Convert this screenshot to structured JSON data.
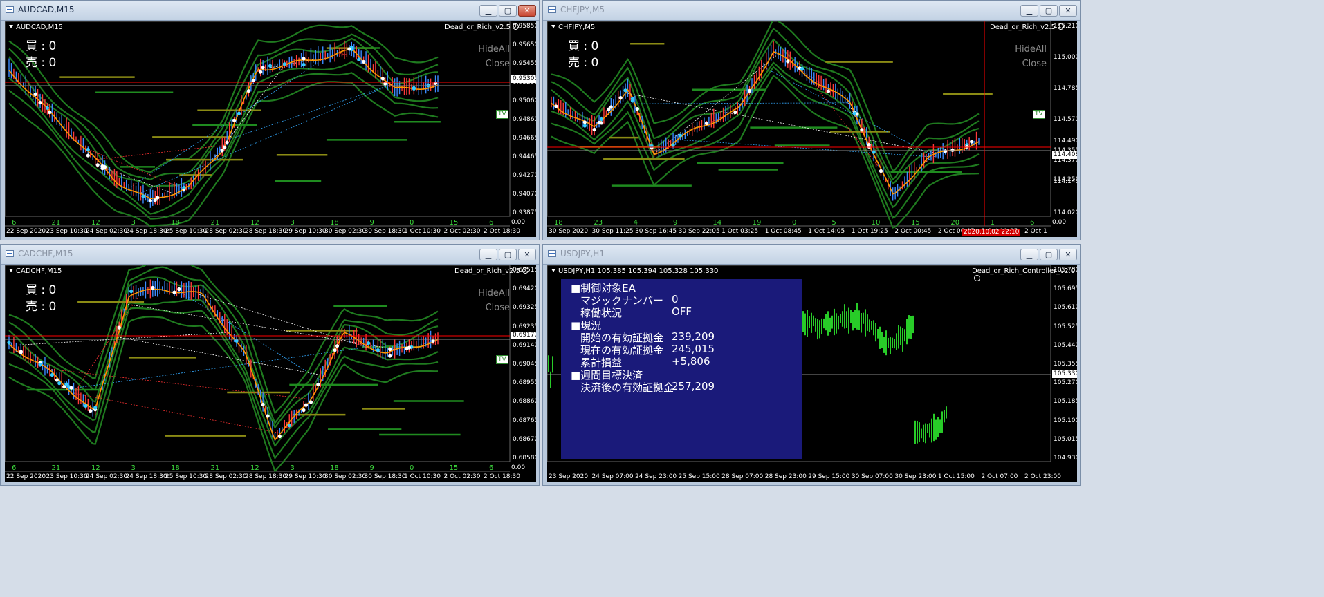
{
  "windows": {
    "audcad": {
      "title": "AUDCAD,M15",
      "symbol": "AUDCAD,M15",
      "indicator": "Dead_or_Rich_v2.5",
      "buy": "買 : 0",
      "sell": "売 : 0",
      "hideall": "HideAll",
      "close_label": "Close",
      "tv": "TV",
      "prices": [
        "0.95850",
        "0.95650",
        "0.95455",
        "0.95255",
        "0.95060",
        "0.94860",
        "0.94665",
        "0.94465",
        "0.94270",
        "0.94070",
        "0.93875"
      ],
      "price_current": "0.95305",
      "price_zero": "0.00",
      "times": [
        "22 Sep 2020",
        "23 Sep 10:30",
        "24 Sep 02:30",
        "24 Sep 18:30",
        "25 Sep 10:30",
        "28 Sep 02:30",
        "28 Sep 18:30",
        "29 Sep 10:30",
        "30 Sep 02:30",
        "30 Sep 18:30",
        "1 Oct 10:30",
        "2 Oct 02:30",
        "2 Oct 18:30"
      ],
      "tick_numbers": [
        "6",
        "21",
        "12",
        "3",
        "18",
        "21",
        "12",
        "3",
        "18",
        "9",
        "0",
        "15",
        "6"
      ]
    },
    "chfjpy": {
      "title": "CHFJPY,M5",
      "symbol": "CHFJPY,M5",
      "indicator": "Dead_or_Rich_v2.5",
      "buy": "買 : 0",
      "sell": "売 : 0",
      "hideall": "HideAll",
      "close_label": "Close",
      "tv": "TV",
      "prices": [
        "115.210",
        "115.000",
        "114.785",
        "114.570",
        "114.355",
        "114.140",
        "114.020"
      ],
      "prices_mid": [
        "114.490",
        "114.370",
        "114.250"
      ],
      "price_current": "114.408",
      "price_zero": "0.00",
      "times": [
        "30 Sep 2020",
        "30 Sep 11:25",
        "30 Sep 16:45",
        "30 Sep 22:05",
        "1 Oct 03:25",
        "1 Oct 08:45",
        "1 Oct 14:05",
        "1 Oct 19:25",
        "2 Oct 00:45",
        "2 Oct 06:05",
        "2 Oct 11:25",
        "2 Oct 1"
      ],
      "time_marker": "2020.10.02 22:10",
      "tick_numbers": [
        "18",
        "23",
        "4",
        "9",
        "14",
        "19",
        "0",
        "5",
        "10",
        "15",
        "20",
        "1",
        "6"
      ]
    },
    "cadchf": {
      "title": "CADCHF,M15",
      "symbol": "CADCHF,M15",
      "indicator": "Dead_or_Rich_v2.5",
      "buy": "買 : 0",
      "sell": "売 : 0",
      "hideall": "HideAll",
      "close_label": "Close",
      "tv": "TV",
      "prices": [
        "0.69515",
        "0.69420",
        "0.69325",
        "0.69235",
        "0.69140",
        "0.69045",
        "0.68955",
        "0.68860",
        "0.68765",
        "0.68670",
        "0.68580"
      ],
      "price_current": "0.69177",
      "price_zero": "0.00",
      "times": [
        "22 Sep 2020",
        "23 Sep 10:30",
        "24 Sep 02:30",
        "24 Sep 18:30",
        "25 Sep 10:30",
        "28 Sep 02:30",
        "28 Sep 18:30",
        "29 Sep 10:30",
        "30 Sep 02:30",
        "30 Sep 18:30",
        "1 Oct 10:30",
        "2 Oct 02:30",
        "2 Oct 18:30"
      ],
      "tick_numbers": [
        "6",
        "21",
        "12",
        "3",
        "18",
        "21",
        "12",
        "3",
        "18",
        "9",
        "0",
        "15",
        "6"
      ]
    },
    "usdjpy": {
      "title": "USDJPY,H1",
      "symbol": "USDJPY,H1  105.385 105.394 105.328 105.330",
      "indicator": "Dead_or_Rich_Controller_v2.0",
      "prices": [
        "105.780",
        "105.695",
        "105.610",
        "105.525",
        "105.440",
        "105.355",
        "105.270",
        "105.185",
        "105.100",
        "105.015",
        "104.930"
      ],
      "price_current": "105.330",
      "times": [
        "23 Sep 2020",
        "24 Sep 07:00",
        "24 Sep 23:00",
        "25 Sep 15:00",
        "28 Sep 07:00",
        "28 Sep 23:00",
        "29 Sep 15:00",
        "30 Sep 07:00",
        "30 Sep 23:00",
        "1 Oct 15:00",
        "2 Oct 07:00",
        "2 Oct 23:00"
      ],
      "panel": {
        "h1": "■制御対象EA",
        "magic_label": "マジックナンバー",
        "magic_value": "0",
        "status_label": "稼働状況",
        "status_value": "OFF",
        "h2": "■現況",
        "start_label": "開始の有効証拠金",
        "start_value": "239,209",
        "current_label": "現在の有効証拠金",
        "current_value": "245,015",
        "pl_label": "累計損益",
        "pl_value": "+5,806",
        "h3": "■週間目標決済",
        "after_label": "決済後の有効証拠金",
        "after_value": "257,209"
      }
    }
  },
  "colors": {
    "chart_bg": "#000000",
    "band": "#1f7a1f",
    "ma": "#ff9900",
    "bid_line": "#ff0000",
    "candles_usdjpy": "#33ff33",
    "panel_bg": "#1a1a7a"
  },
  "icons": {
    "window": "chart-window-icon",
    "minimize": "minimize-icon",
    "maximize": "maximize-icon",
    "close": "close-icon",
    "smiley": "smiley-icon"
  }
}
